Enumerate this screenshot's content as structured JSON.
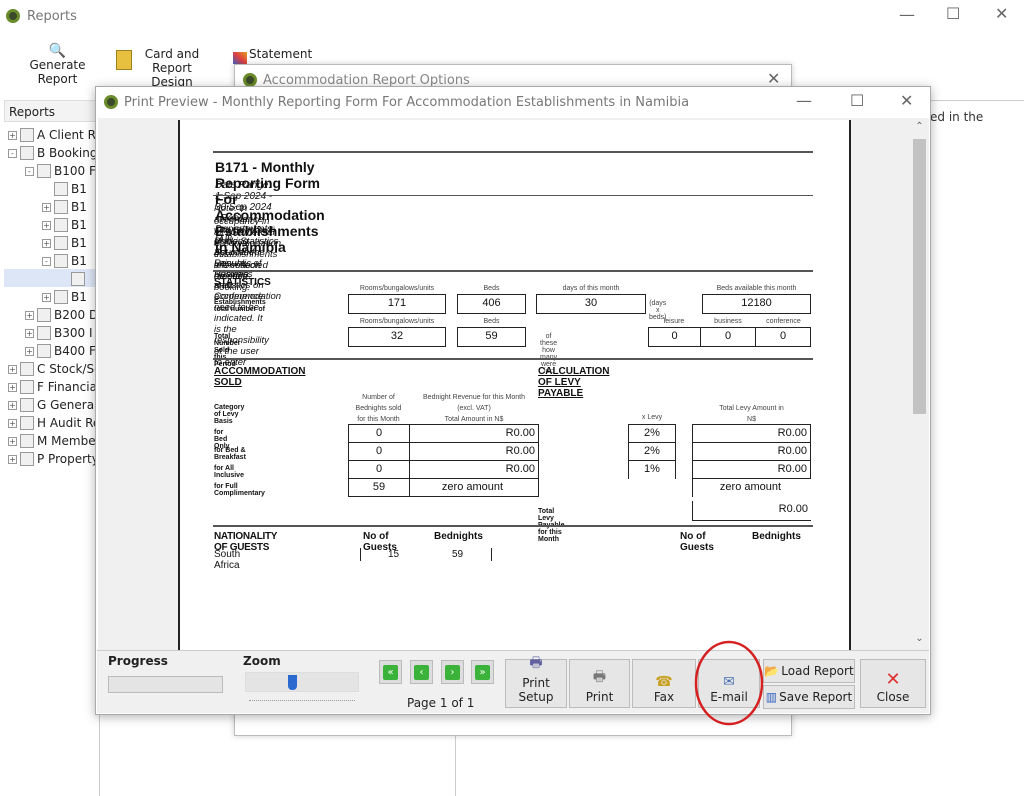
{
  "app": {
    "title": "Reports"
  },
  "toolbar": {
    "generate": "Generate Report",
    "card1": "Card and",
    "card2": "Report Design",
    "statement": "Statement"
  },
  "left_panel": {
    "header": "Reports",
    "items": [
      {
        "label": "A Client Re",
        "level": 0,
        "exp": "+"
      },
      {
        "label": "B Booking",
        "level": 0,
        "exp": "-"
      },
      {
        "label": "B100 F",
        "level": 1,
        "exp": "-"
      },
      {
        "label": "B1",
        "level": 2,
        "exp": ""
      },
      {
        "label": "B1",
        "level": 2,
        "exp": "+"
      },
      {
        "label": "B1",
        "level": 2,
        "exp": "+"
      },
      {
        "label": "B1",
        "level": 2,
        "exp": "+"
      },
      {
        "label": "B1",
        "level": 2,
        "exp": "-"
      },
      {
        "label": "",
        "level": 3,
        "exp": ""
      },
      {
        "label": "B1",
        "level": 2,
        "exp": "+"
      },
      {
        "label": "B200 D",
        "level": 1,
        "exp": "+"
      },
      {
        "label": "B300 I",
        "level": 1,
        "exp": "+"
      },
      {
        "label": "B400 F",
        "level": 1,
        "exp": "+"
      },
      {
        "label": "C Stock/Se",
        "level": 0,
        "exp": "+"
      },
      {
        "label": "F Financia",
        "level": 0,
        "exp": "+"
      },
      {
        "label": "G General",
        "level": 0,
        "exp": "+"
      },
      {
        "label": "H Audit Re",
        "level": 0,
        "exp": "+"
      },
      {
        "label": "M Member",
        "level": 0,
        "exp": "+"
      },
      {
        "label": "P Property",
        "level": 0,
        "exp": "+"
      }
    ]
  },
  "right_panel": {
    "text": "ed in the"
  },
  "options_dialog": {
    "title": "Accommodation Report Options"
  },
  "preview": {
    "title": "Print Preview - Monthly Reporting Form For Accommodation Establishments in Namibia"
  },
  "doc": {
    "title": "B171 - Monthly Reporting Form For Accommodation Establishments in Namibia",
    "date_range": "Date Range: 1 Sep 2024 - 30 Sep 2024 / Root Departments: [All]",
    "note1": "Note: In accordance with Section 4 of the Statistics Act of the Republic of Namibia, statistics on accommodation",
    "note2": "occupancy in all commercial accommodation establishments are collected monthly.",
    "note3": "Booking Sources for Leisure, Business and Conference need to be indicated. It is the responsibility of the user to enter",
    "note4": "this information on each booking.",
    "stats": {
      "heading": "STATISTICS",
      "row1_label": "Establishments total number of",
      "row2_label": "Total Number Sold this Period",
      "h_rooms": "Rooms/bungalows/units",
      "h_beds": "Beds",
      "h_days": "days of this month",
      "h_bedsavail": "Beds available this month",
      "days_x_beds": "(days x beds)",
      "rooms": "171",
      "beds": "406",
      "days": "30",
      "beds_avail": "12180",
      "sold_rooms": "32",
      "sold_beds": "59",
      "of_these": "of these how many were for:",
      "h_leisure": "leisure",
      "h_business": "business",
      "h_conference": "conference",
      "leisure": "0",
      "business": "0",
      "conference": "0"
    },
    "acc": {
      "heading": "ACCOMMODATION SOLD",
      "levy_heading": "CALCULATION OF LEVY PAYABLE",
      "category": "Category of Levy Basis",
      "h_bn1": "Number of",
      "h_bn2": "Bednights sold",
      "h_bn3": "for this Month",
      "h_rev1": "Bednight Revenue for this Month",
      "h_rev2": "(excl. VAT)",
      "h_rev3": "Total Amount in N$",
      "h_levy": "x Levy",
      "h_total1": "Total Levy Amount in",
      "h_total2": "N$",
      "rows": [
        {
          "label": "for Bed Only",
          "bednights": "0",
          "revenue": "R0.00",
          "levy": "2%",
          "total": "R0.00"
        },
        {
          "label": "for Bed & Breakfast",
          "bednights": "0",
          "revenue": "R0.00",
          "levy": "2%",
          "total": "R0.00"
        },
        {
          "label": "for All Inclusive",
          "bednights": "0",
          "revenue": "R0.00",
          "levy": "1%",
          "total": "R0.00"
        },
        {
          "label": "for Full Complimentary",
          "bednights": "59",
          "revenue": "zero amount",
          "levy": "",
          "total": "zero amount"
        }
      ],
      "total_label": "Total Levy Payable for this Month",
      "total_value": "R0.00"
    },
    "nat": {
      "heading": "NATIONALITY OF GUESTS",
      "h_guests": "No of Guests",
      "h_bednights": "Bednights",
      "h_guests2": "No of Guests",
      "h_bednights2": "Bednights",
      "rows": [
        {
          "country": "South Africa",
          "guests": "15",
          "bednights": "59"
        }
      ]
    }
  },
  "bottom": {
    "progress": "Progress",
    "progress_value": 0,
    "zoom": "Zoom",
    "zoom_level": 0.42,
    "page": "Page 1 of 1",
    "print_setup": "Print Setup",
    "print": "Print",
    "fax": "Fax",
    "email": "E-mail",
    "load": "Load Report",
    "save": "Save Report",
    "close": "Close"
  },
  "colors": {
    "highlight_circle": "#d42020",
    "nav_green": "#3bb33b"
  }
}
